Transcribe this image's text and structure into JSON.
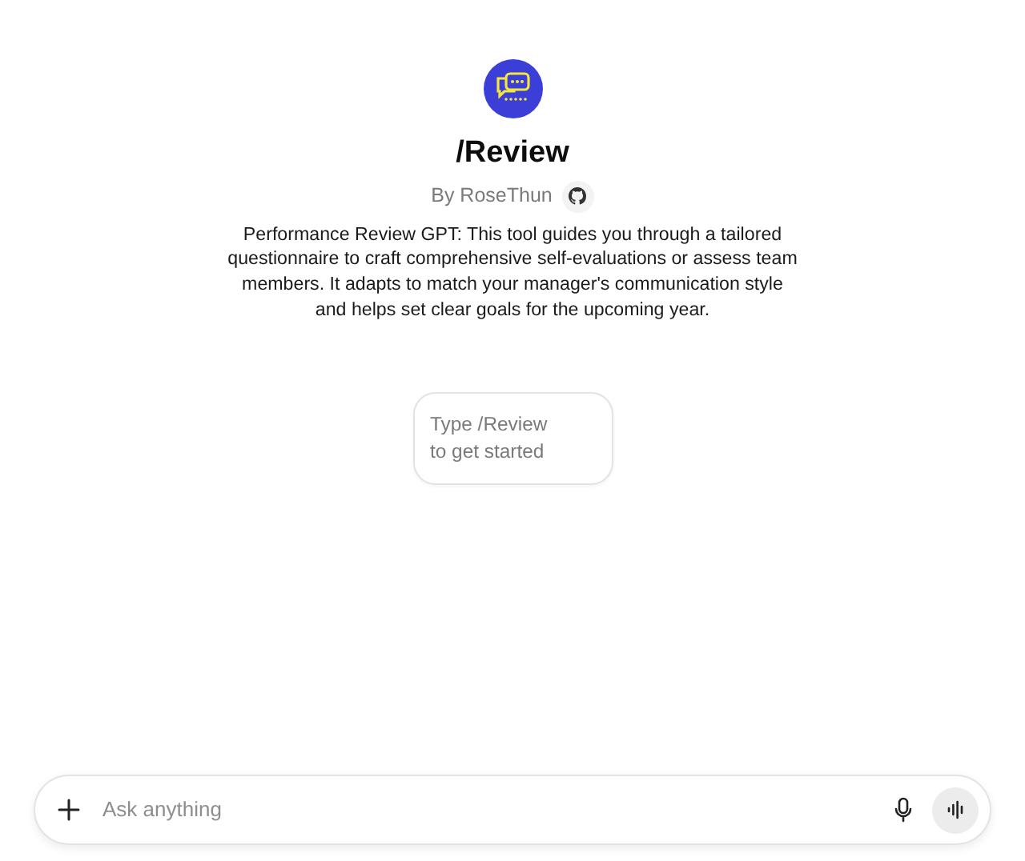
{
  "gpt": {
    "name": "/Review",
    "author": "By RoseThun",
    "description": "Performance Review GPT: This tool guides you through a tailored questionnaire to craft comprehensive self-evaluations or assess team members. It adapts to match your manager's communication style and helps set clear goals for the upcoming year."
  },
  "starters": [
    {
      "text": "Type /Review to get started"
    }
  ],
  "composer": {
    "placeholder": "Ask anything"
  }
}
